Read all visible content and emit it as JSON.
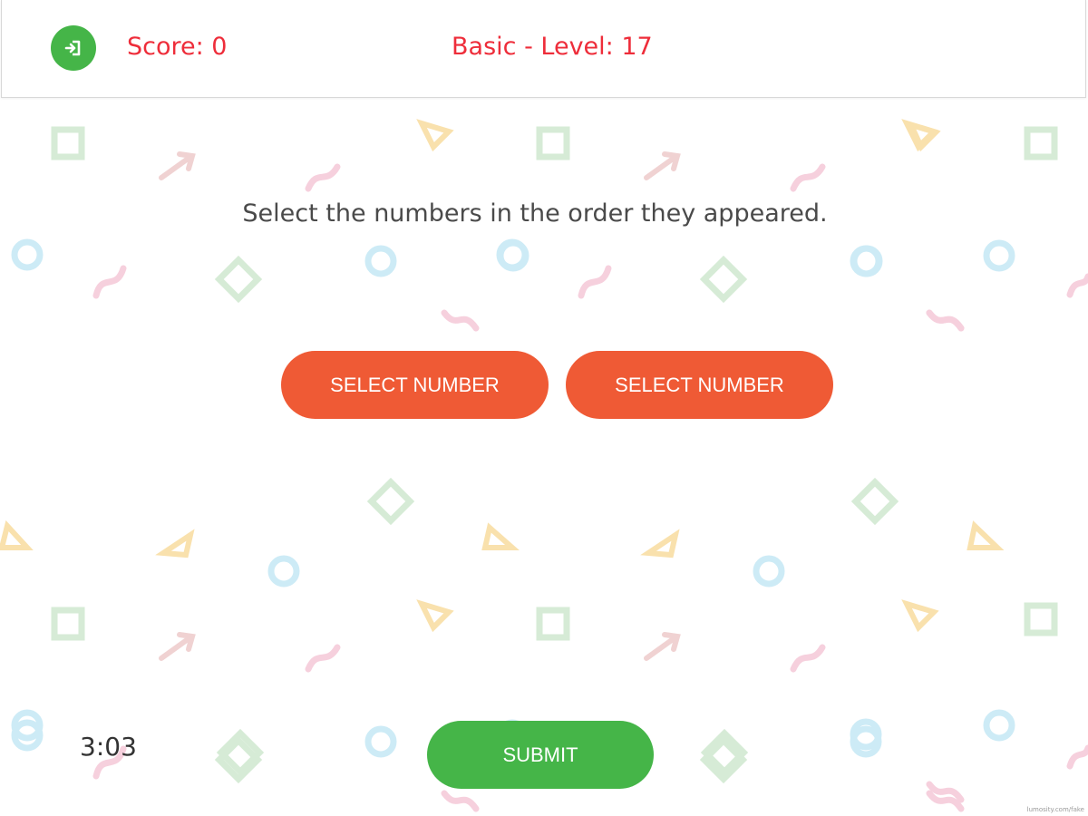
{
  "header": {
    "exit_icon": "exit-icon",
    "score_text": "Score: 0",
    "level_text": "Basic - Level: 17"
  },
  "game": {
    "instruction": "Select the numbers in the order they appeared.",
    "select_buttons": [
      "SELECT NUMBER",
      "SELECT NUMBER"
    ],
    "submit_label": "SUBMIT",
    "timer": "3:03"
  },
  "footer": {
    "watermark": "lumosity.com/fake"
  },
  "colors": {
    "accent_green": "#45b548",
    "select_orange": "#ef5a35",
    "header_text_red": "#ee2d3a",
    "pattern_green": "#cfe8cf",
    "pattern_blue": "#bfe4f2",
    "pattern_pink": "#f6c6d6",
    "pattern_yellow": "#f9e1ad"
  }
}
